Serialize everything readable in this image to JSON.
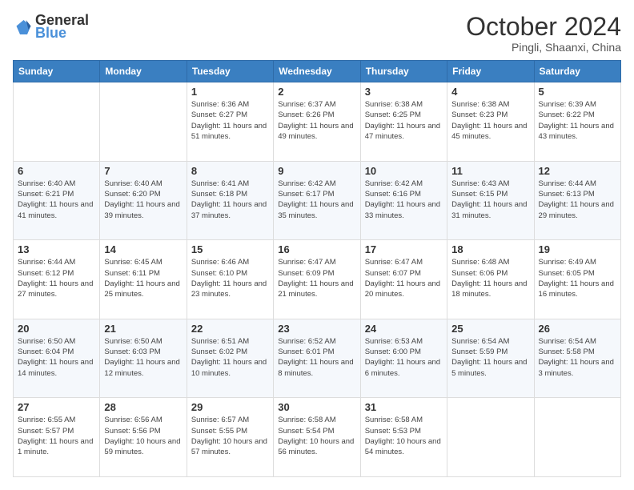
{
  "logo": {
    "line1": "General",
    "line2": "Blue"
  },
  "title": "October 2024",
  "location": "Pingli, Shaanxi, China",
  "weekdays": [
    "Sunday",
    "Monday",
    "Tuesday",
    "Wednesday",
    "Thursday",
    "Friday",
    "Saturday"
  ],
  "weeks": [
    [
      {
        "day": "",
        "info": ""
      },
      {
        "day": "",
        "info": ""
      },
      {
        "day": "1",
        "info": "Sunrise: 6:36 AM\nSunset: 6:27 PM\nDaylight: 11 hours and 51 minutes."
      },
      {
        "day": "2",
        "info": "Sunrise: 6:37 AM\nSunset: 6:26 PM\nDaylight: 11 hours and 49 minutes."
      },
      {
        "day": "3",
        "info": "Sunrise: 6:38 AM\nSunset: 6:25 PM\nDaylight: 11 hours and 47 minutes."
      },
      {
        "day": "4",
        "info": "Sunrise: 6:38 AM\nSunset: 6:23 PM\nDaylight: 11 hours and 45 minutes."
      },
      {
        "day": "5",
        "info": "Sunrise: 6:39 AM\nSunset: 6:22 PM\nDaylight: 11 hours and 43 minutes."
      }
    ],
    [
      {
        "day": "6",
        "info": "Sunrise: 6:40 AM\nSunset: 6:21 PM\nDaylight: 11 hours and 41 minutes."
      },
      {
        "day": "7",
        "info": "Sunrise: 6:40 AM\nSunset: 6:20 PM\nDaylight: 11 hours and 39 minutes."
      },
      {
        "day": "8",
        "info": "Sunrise: 6:41 AM\nSunset: 6:18 PM\nDaylight: 11 hours and 37 minutes."
      },
      {
        "day": "9",
        "info": "Sunrise: 6:42 AM\nSunset: 6:17 PM\nDaylight: 11 hours and 35 minutes."
      },
      {
        "day": "10",
        "info": "Sunrise: 6:42 AM\nSunset: 6:16 PM\nDaylight: 11 hours and 33 minutes."
      },
      {
        "day": "11",
        "info": "Sunrise: 6:43 AM\nSunset: 6:15 PM\nDaylight: 11 hours and 31 minutes."
      },
      {
        "day": "12",
        "info": "Sunrise: 6:44 AM\nSunset: 6:13 PM\nDaylight: 11 hours and 29 minutes."
      }
    ],
    [
      {
        "day": "13",
        "info": "Sunrise: 6:44 AM\nSunset: 6:12 PM\nDaylight: 11 hours and 27 minutes."
      },
      {
        "day": "14",
        "info": "Sunrise: 6:45 AM\nSunset: 6:11 PM\nDaylight: 11 hours and 25 minutes."
      },
      {
        "day": "15",
        "info": "Sunrise: 6:46 AM\nSunset: 6:10 PM\nDaylight: 11 hours and 23 minutes."
      },
      {
        "day": "16",
        "info": "Sunrise: 6:47 AM\nSunset: 6:09 PM\nDaylight: 11 hours and 21 minutes."
      },
      {
        "day": "17",
        "info": "Sunrise: 6:47 AM\nSunset: 6:07 PM\nDaylight: 11 hours and 20 minutes."
      },
      {
        "day": "18",
        "info": "Sunrise: 6:48 AM\nSunset: 6:06 PM\nDaylight: 11 hours and 18 minutes."
      },
      {
        "day": "19",
        "info": "Sunrise: 6:49 AM\nSunset: 6:05 PM\nDaylight: 11 hours and 16 minutes."
      }
    ],
    [
      {
        "day": "20",
        "info": "Sunrise: 6:50 AM\nSunset: 6:04 PM\nDaylight: 11 hours and 14 minutes."
      },
      {
        "day": "21",
        "info": "Sunrise: 6:50 AM\nSunset: 6:03 PM\nDaylight: 11 hours and 12 minutes."
      },
      {
        "day": "22",
        "info": "Sunrise: 6:51 AM\nSunset: 6:02 PM\nDaylight: 11 hours and 10 minutes."
      },
      {
        "day": "23",
        "info": "Sunrise: 6:52 AM\nSunset: 6:01 PM\nDaylight: 11 hours and 8 minutes."
      },
      {
        "day": "24",
        "info": "Sunrise: 6:53 AM\nSunset: 6:00 PM\nDaylight: 11 hours and 6 minutes."
      },
      {
        "day": "25",
        "info": "Sunrise: 6:54 AM\nSunset: 5:59 PM\nDaylight: 11 hours and 5 minutes."
      },
      {
        "day": "26",
        "info": "Sunrise: 6:54 AM\nSunset: 5:58 PM\nDaylight: 11 hours and 3 minutes."
      }
    ],
    [
      {
        "day": "27",
        "info": "Sunrise: 6:55 AM\nSunset: 5:57 PM\nDaylight: 11 hours and 1 minute."
      },
      {
        "day": "28",
        "info": "Sunrise: 6:56 AM\nSunset: 5:56 PM\nDaylight: 10 hours and 59 minutes."
      },
      {
        "day": "29",
        "info": "Sunrise: 6:57 AM\nSunset: 5:55 PM\nDaylight: 10 hours and 57 minutes."
      },
      {
        "day": "30",
        "info": "Sunrise: 6:58 AM\nSunset: 5:54 PM\nDaylight: 10 hours and 56 minutes."
      },
      {
        "day": "31",
        "info": "Sunrise: 6:58 AM\nSunset: 5:53 PM\nDaylight: 10 hours and 54 minutes."
      },
      {
        "day": "",
        "info": ""
      },
      {
        "day": "",
        "info": ""
      }
    ]
  ]
}
